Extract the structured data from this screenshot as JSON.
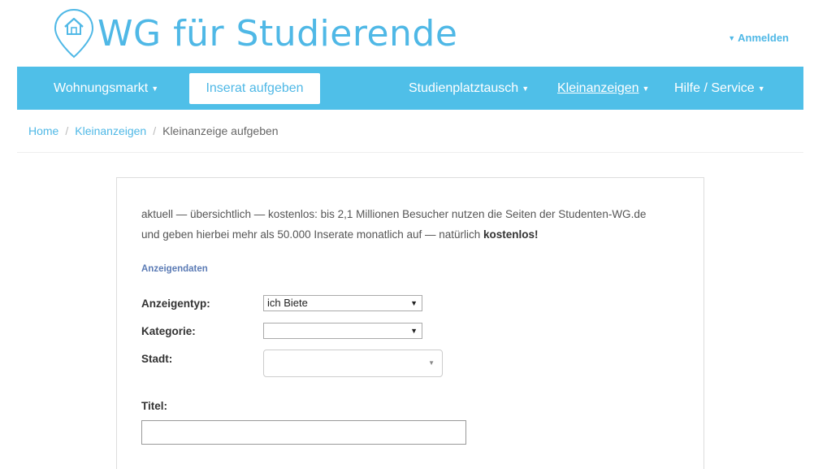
{
  "header": {
    "logo_text": "WG für Studierende",
    "login_label": "Anmelden"
  },
  "nav": {
    "items": [
      {
        "label": "Wohnungsmarkt"
      },
      {
        "label": "Studienplatztausch"
      },
      {
        "label": "Kleinanzeigen"
      },
      {
        "label": "Hilfe / Service"
      }
    ],
    "cta_label": "Inserat aufgeben"
  },
  "breadcrumb": {
    "home": "Home",
    "section": "Kleinanzeigen",
    "current": "Kleinanzeige aufgeben",
    "separator": "/"
  },
  "form": {
    "intro_text": "aktuell — übersichtlich — kostenlos: bis 2,1 Millionen Besucher nutzen die Seiten der Studenten-WG.de und geben hierbei mehr als 50.000 Inserate monatlich auf — natürlich ",
    "intro_bold": "kostenlos!",
    "section_title": "Anzeigendaten",
    "fields": {
      "type_label": "Anzeigentyp:",
      "type_value": "ich Biete",
      "category_label": "Kategorie:",
      "category_value": "",
      "city_label": "Stadt:",
      "city_value": "",
      "title_label": "Titel:",
      "title_value": ""
    }
  },
  "colors": {
    "brand": "#4fb8e6",
    "navbar": "#4fbfe8",
    "section_title": "#5b7bb5"
  },
  "icons": {
    "logo": "map-pin-house-icon",
    "caret": "caret-down-icon",
    "select_arrow": "select-arrow-icon"
  }
}
